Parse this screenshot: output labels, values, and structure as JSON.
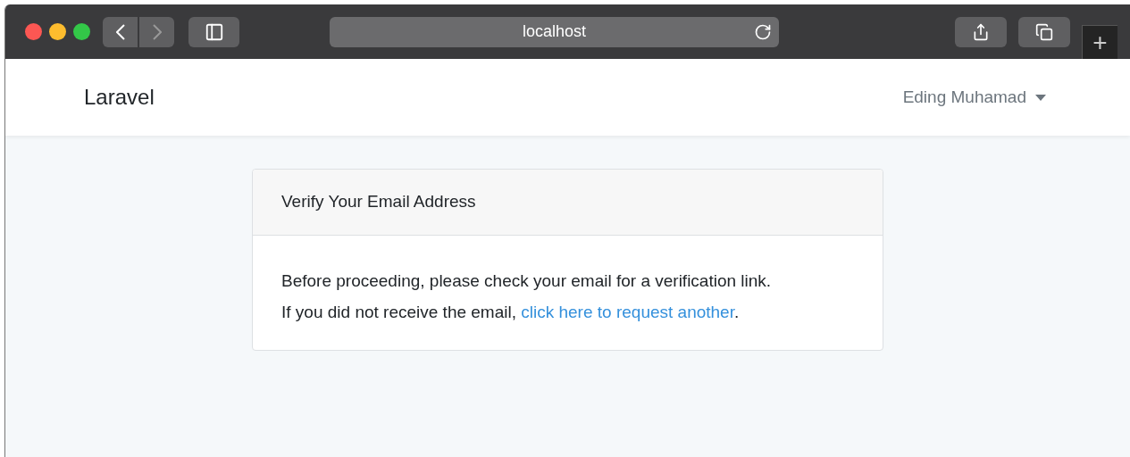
{
  "browser": {
    "address": "localhost",
    "back_disabled": false,
    "forward_disabled": true,
    "new_tab": "+"
  },
  "navbar": {
    "brand": "Laravel",
    "user": "Eding Muhamad"
  },
  "card": {
    "title": "Verify Your Email Address",
    "message": "Before proceeding, please check your email for a verification link.",
    "prompt": "If you did not receive the email,",
    "link": "click here to request another",
    "ending": "."
  }
}
